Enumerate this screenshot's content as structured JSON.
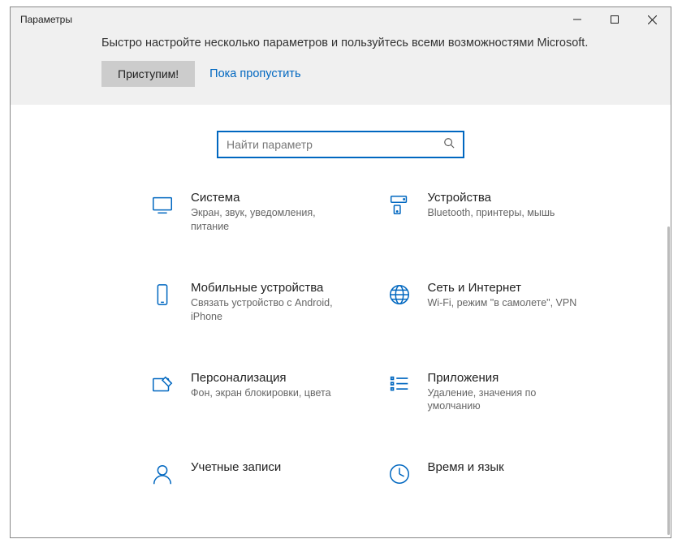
{
  "window": {
    "title": "Параметры"
  },
  "banner": {
    "text": "Быстро настройте несколько параметров и пользуйтесь всеми возможностями Microsoft.",
    "start_label": "Приступим!",
    "skip_label": "Пока пропустить"
  },
  "search": {
    "placeholder": "Найти параметр"
  },
  "tiles": [
    {
      "title": "Система",
      "sub": "Экран, звук, уведомления, питание"
    },
    {
      "title": "Устройства",
      "sub": "Bluetooth, принтеры, мышь"
    },
    {
      "title": "Мобильные устройства",
      "sub": "Связать устройство с Android, iPhone"
    },
    {
      "title": "Сеть и Интернет",
      "sub": "Wi-Fi, режим \"в самолете\", VPN"
    },
    {
      "title": "Персонализация",
      "sub": "Фон, экран блокировки, цвета"
    },
    {
      "title": "Приложения",
      "sub": "Удаление, значения по умолчанию"
    },
    {
      "title": "Учетные записи",
      "sub": ""
    },
    {
      "title": "Время и язык",
      "sub": ""
    }
  ]
}
